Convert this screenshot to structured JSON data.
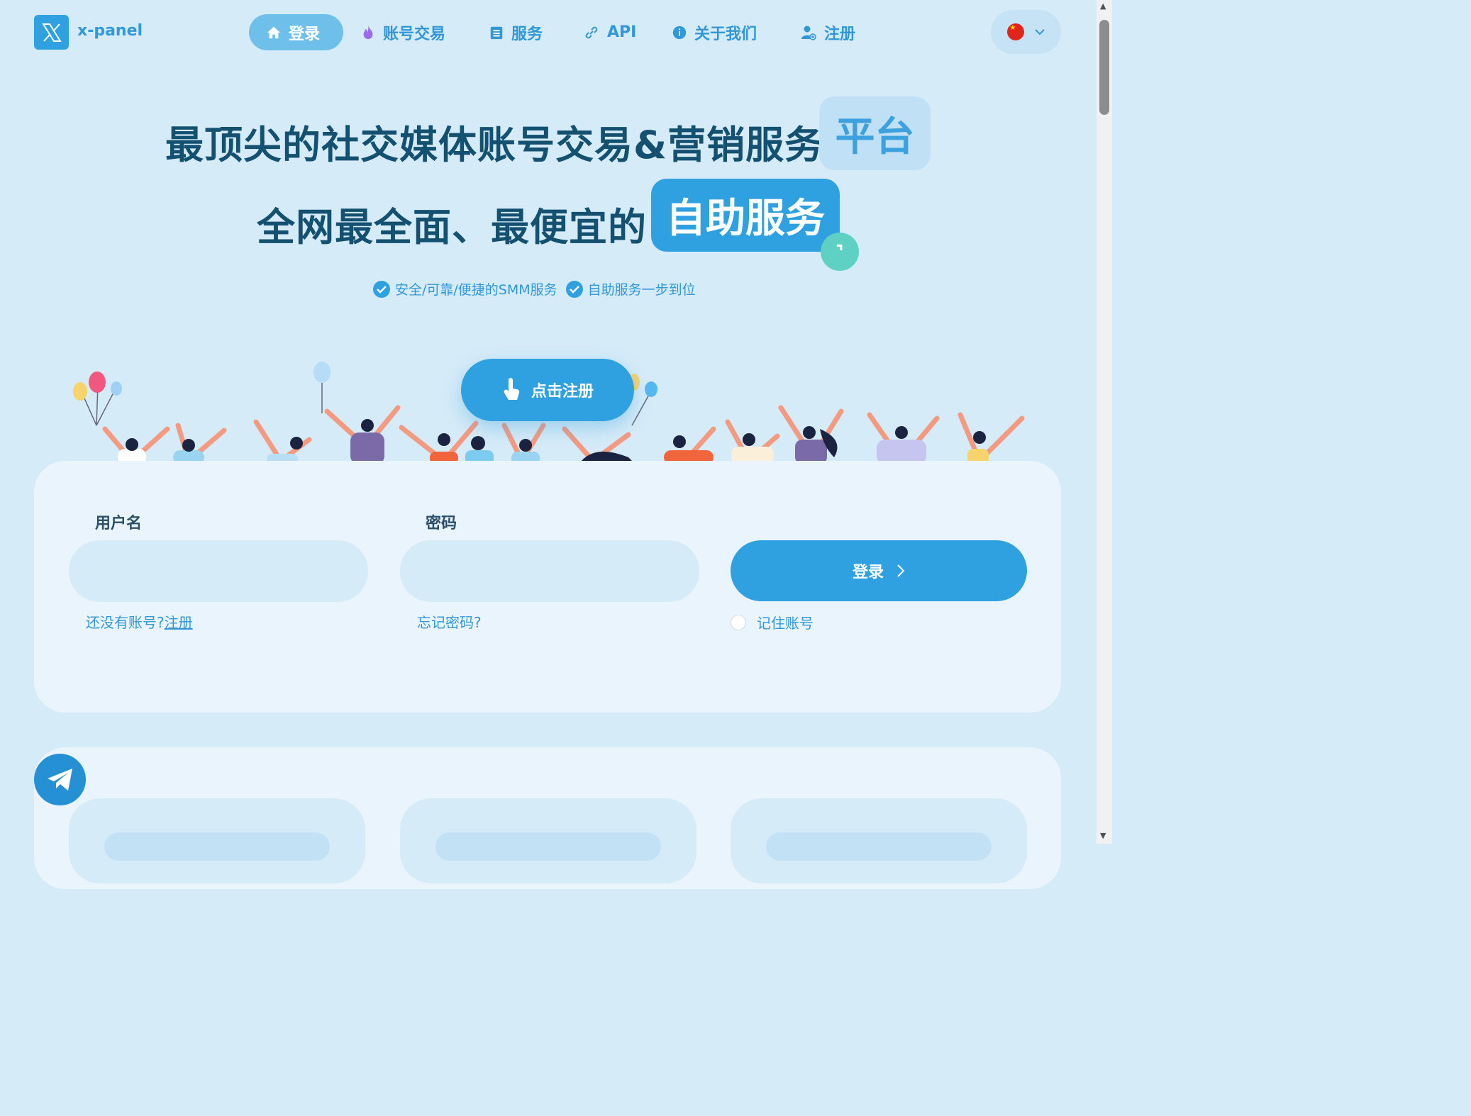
{
  "header": {
    "brand": "x-panel",
    "nav": [
      {
        "label": "登录",
        "icon": "home-icon",
        "active": true
      },
      {
        "label": "账号交易",
        "icon": "fire-icon"
      },
      {
        "label": "服务",
        "icon": "list-icon"
      },
      {
        "label": "API",
        "icon": "link-icon"
      },
      {
        "label": "关于我们",
        "icon": "info-icon"
      },
      {
        "label": "注册",
        "icon": "user-add-icon"
      }
    ],
    "language": {
      "flag": "china-flag-icon"
    }
  },
  "hero": {
    "title_line1": "最顶尖的社交媒体账号交易&营销服务",
    "title_tag1": "平台",
    "title_line2": "全网最全面、最便宜的",
    "title_tag2": "自助服务",
    "features": [
      "安全/可靠/便捷的SMM服务",
      "自助服务一步到位"
    ],
    "cta_label": "点击注册"
  },
  "login_form": {
    "username_label": "用户名",
    "password_label": "密码",
    "username_value": "",
    "password_value": "",
    "submit_label": "登录",
    "no_account_text": "还没有账号?",
    "register_link": "注册",
    "forgot_password": "忘记密码?",
    "remember_label": "记住账号"
  },
  "colors": {
    "accent": "#2fa0e0",
    "background": "#d6ebf8",
    "card": "#e9f4fc",
    "heading": "#14506f"
  }
}
